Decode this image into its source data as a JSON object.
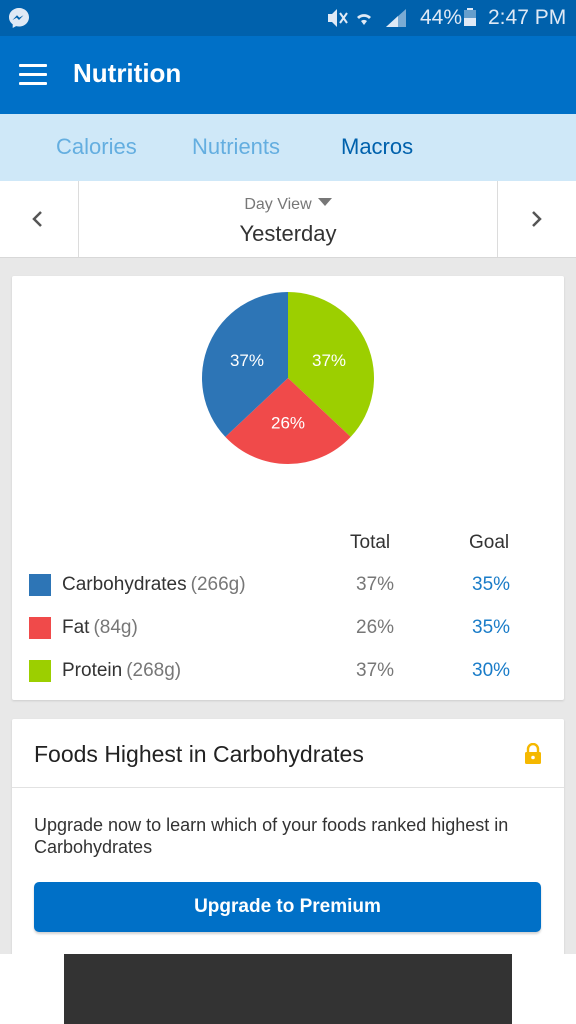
{
  "status_bar": {
    "battery": "44%",
    "time": "2:47 PM",
    "icons": [
      "messenger-icon",
      "mute-icon",
      "wifi-icon",
      "signal-icon",
      "battery-icon"
    ]
  },
  "app_bar": {
    "title": "Nutrition",
    "menu_icon": "hamburger-menu-icon"
  },
  "tabs": [
    {
      "label": "Calories",
      "active": false
    },
    {
      "label": "Nutrients",
      "active": false
    },
    {
      "label": "Macros",
      "active": true
    }
  ],
  "date_selector": {
    "mode_label": "Day View",
    "date_label": "Yesterday"
  },
  "macros": {
    "columns": {
      "total": "Total",
      "goal": "Goal"
    },
    "rows": [
      {
        "name": "Carbohydrates",
        "grams": "(266g)",
        "total": "37%",
        "goal": "35%",
        "color": "#2d75b6"
      },
      {
        "name": "Fat",
        "grams": "(84g)",
        "total": "26%",
        "goal": "35%",
        "color": "#f04a4a"
      },
      {
        "name": "Protein",
        "grams": "(268g)",
        "total": "37%",
        "goal": "30%",
        "color": "#9ccf00"
      }
    ]
  },
  "chart_data": {
    "type": "pie",
    "slices": [
      {
        "label": "Protein",
        "value": 37,
        "text": "37%",
        "color": "#9ccf00"
      },
      {
        "label": "Fat",
        "value": 26,
        "text": "26%",
        "color": "#f04a4a"
      },
      {
        "label": "Carbohydrates",
        "value": 37,
        "text": "37%",
        "color": "#2d75b6"
      }
    ]
  },
  "foods_card": {
    "title": "Foods Highest in Carbohydrates",
    "message": "Upgrade now to learn which of your foods ranked highest in Carbohydrates",
    "button_label": "Upgrade to Premium",
    "lock_color": "#f5b800"
  },
  "colors": {
    "primary": "#0070c7",
    "status_bar": "#0061ac",
    "tab_bg": "#cfe8f8"
  }
}
